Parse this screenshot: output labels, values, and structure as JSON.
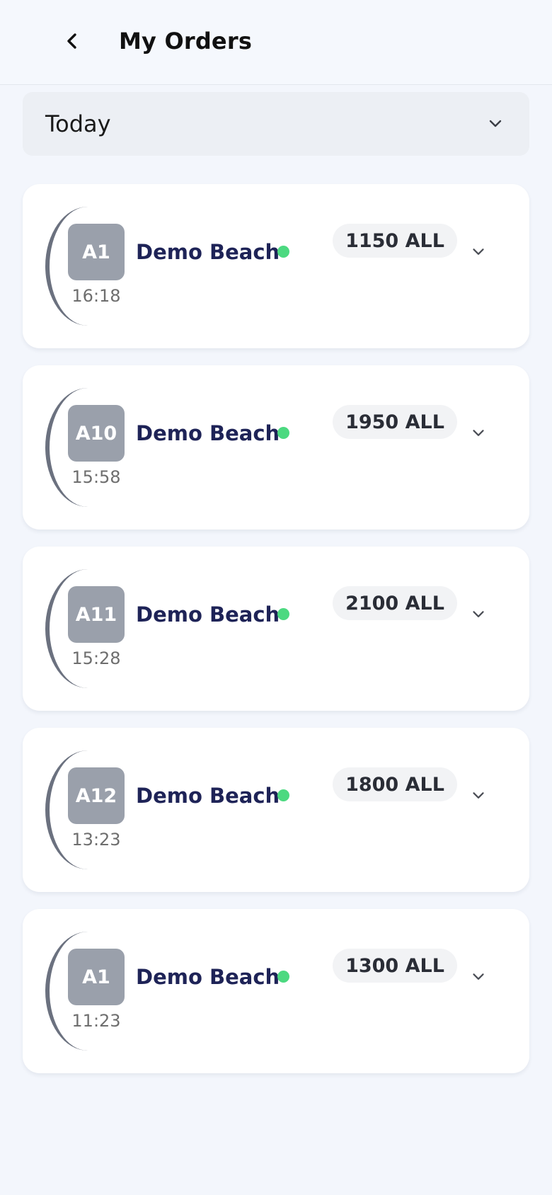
{
  "header": {
    "title": "My Orders",
    "back_icon": "chevron-left-icon"
  },
  "filter": {
    "selected": "Today",
    "icon": "chevron-down-icon"
  },
  "colors": {
    "status_active": "#4cd980",
    "venue_text": "#1e2357",
    "badge_bg": "#9aa0ab"
  },
  "orders": [
    {
      "table": "A1",
      "venue": "Demo Beach",
      "time": "16:18",
      "amount": "1150 ALL"
    },
    {
      "table": "A10",
      "venue": "Demo Beach",
      "time": "15:58",
      "amount": "1950 ALL"
    },
    {
      "table": "A11",
      "venue": "Demo Beach",
      "time": "15:28",
      "amount": "2100 ALL"
    },
    {
      "table": "A12",
      "venue": "Demo Beach",
      "time": "13:23",
      "amount": "1800 ALL"
    },
    {
      "table": "A1",
      "venue": "Demo Beach",
      "time": "11:23",
      "amount": "1300 ALL"
    }
  ]
}
